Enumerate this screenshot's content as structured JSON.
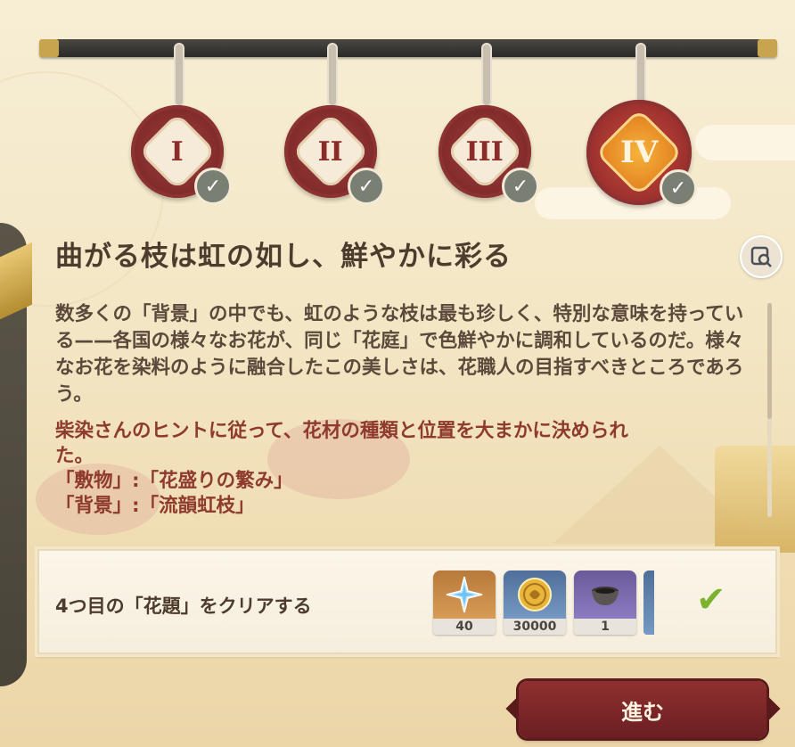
{
  "stages": [
    {
      "numeral": "I",
      "completed": true,
      "active": false
    },
    {
      "numeral": "II",
      "completed": true,
      "active": false
    },
    {
      "numeral": "III",
      "completed": true,
      "active": false
    },
    {
      "numeral": "IV",
      "completed": true,
      "active": true
    }
  ],
  "check_glyph": "✓",
  "title": "曲がる枝は虹の如し、鮮やかに彩る",
  "description": "数多くの「背景」の中でも、虹のような枝は最も珍しく、特別な意味を持っている——各国の様々なお花が、同じ「花庭」で色鮮やかに調和しているのだ。様々なお花を染料のように融合したこの美しさは、花職人の目指すべきところであろう。",
  "hint_lines": [
    "柴染さんのヒントに従って、花材の種類と位置を大まかに決められ",
    "た。",
    "「敷物」:「花盛りの繁み」",
    "「背景」:「流韻虹枝」"
  ],
  "task": {
    "label": "4つ目の「花題」をクリアする",
    "rewards": [
      {
        "icon": "primogem-icon",
        "count": "40"
      },
      {
        "icon": "mora-icon",
        "count": "30000"
      },
      {
        "icon": "bowl-icon",
        "count": "1"
      }
    ],
    "completed_glyph": "✔"
  },
  "proceed_label": "進む",
  "colors": {
    "accent": "#8f2f2f",
    "check": "#7bb32e",
    "title": "#4d3c2e",
    "hint": "#8e3a2c"
  }
}
